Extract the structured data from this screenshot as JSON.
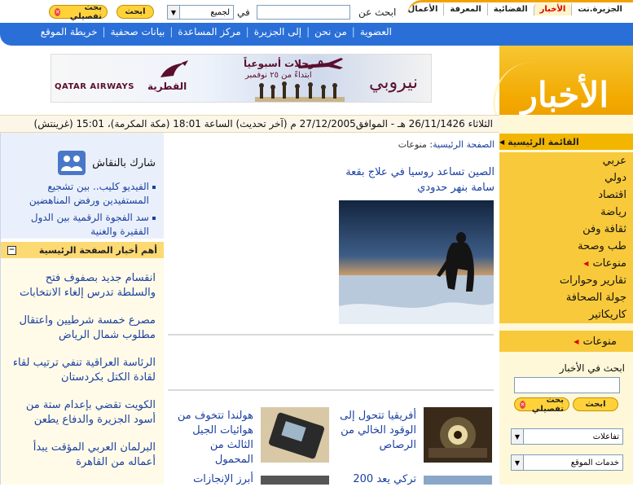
{
  "top_nav": {
    "section_tabs": [
      "الجزيرة.نت",
      "الأخبار",
      "الفضائية",
      "المعرفة",
      "الأعمال"
    ],
    "active_tab": "الأخبار",
    "search_label": "ابحث عن",
    "in_label": "في",
    "scope_value": "لجميع",
    "search_button": "ابحث",
    "advanced_search_button": "بحث تفصيلي",
    "utility_links": [
      "العضوية",
      "من نحن",
      "إلى الجزيرة",
      "مركز المساعدة",
      "بيانات صحفية",
      "خريطة الموقع"
    ]
  },
  "banner": {
    "headline": "٥ رحلات أسبوعياً",
    "subline": "ابتداءً من ٢٥ نوفمبر",
    "city": "نيروبي",
    "airline_en": "QATAR AIRWAYS",
    "airline_ar": "القطرية"
  },
  "brand_title": "الأخبار",
  "date_line": "الثلاثاء 26/11/1426 هـ - الموافق27/12/2005 م (آخر تحديث) الساعة 18:01 (مكة المكرمة)، 15:01 (غرينتش)",
  "right_sidebar": {
    "menu_title": "القائمة الرئيسية",
    "menu_items": [
      "عربي",
      "دولي",
      "اقتصاد",
      "رياضة",
      "ثقافة وفن",
      "طب وصحة",
      "منوعات",
      "تقارير وحوارات",
      "جولة الصحافة",
      "كاريكاتير"
    ],
    "active_menu_item": "منوعات",
    "section_more": "منوعات",
    "news_search_label": "ابحث في الأخبار",
    "search_button": "ابحث",
    "advanced_search_button": "بحث تفصيلي",
    "interactions_select": "تفاعلات",
    "services_select": "خدمات الموقع"
  },
  "left_sidebar": {
    "discuss_title": "شارك بالنقاش",
    "discuss_links": [
      "الفيديو كليب.. بين تشجيع المستفيدين ورفض المناهضين",
      "سد الفجوة الرقمية بين الدول الفقيرة والغنية"
    ],
    "top_news_title": "أهم أخبار الصفحة الرئيسية",
    "top_news": [
      "انقسام جديد بصفوف فتح والسلطة تدرس إلغاء الانتخابات",
      "مصرع خمسة شرطيين واعتقال مطلوب شمال الرياض",
      "الرئاسة العراقية تنفي ترتيب لقاء لقادة الكتل بكردستان",
      "الكويت تقضي بإعدام ستة من أسود الجزيرة والدفاع يطعن",
      "البرلمان العربي المؤقت يبدأ أعماله من القاهرة"
    ]
  },
  "center": {
    "breadcrumb_home": "الصفحة الرئيسية",
    "breadcrumb_sep": ":",
    "breadcrumb_current": "منوعات",
    "main_headline": "الصين تساعد روسيا في علاج بقعة سامة بنهر حدودي",
    "stories": [
      {
        "title": "أفريقيا تتحول إلى الوقود الخالي من الرصاص"
      },
      {
        "title": "هولندا تتخوف من هوائيات الجيل الثالث من المحمول"
      }
    ],
    "cut_stories": [
      "تركي يعد 200",
      "أبرز الإنجازات"
    ]
  },
  "colors": {
    "nav_blue": "#2a6fd8",
    "brand_orange": "#f2a900",
    "link_blue": "#1a3fa0",
    "active_red": "#d60000"
  }
}
